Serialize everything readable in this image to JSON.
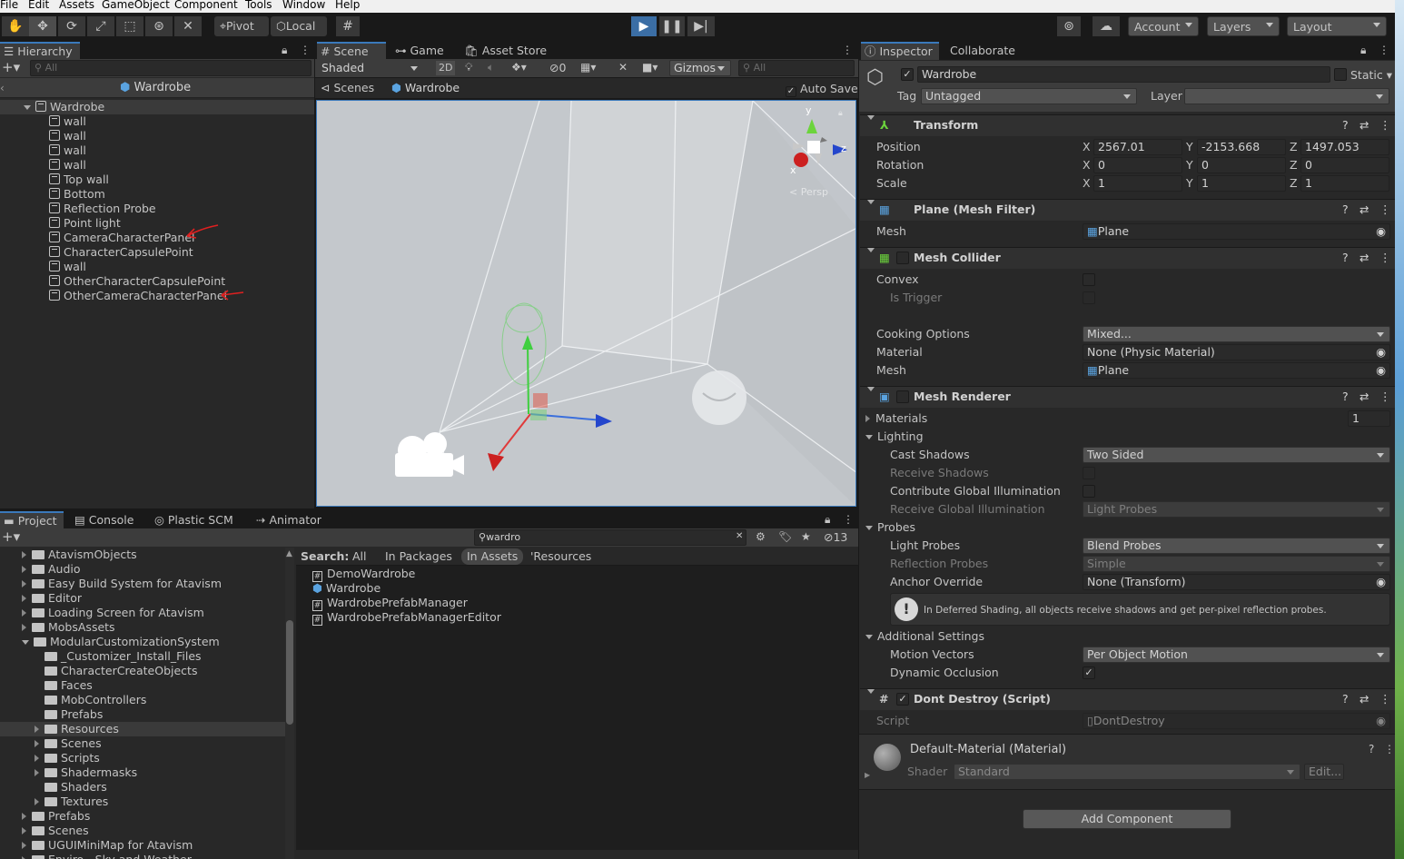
{
  "menu": [
    "File",
    "Edit",
    "Assets",
    "GameObject",
    "Component",
    "Tools",
    "Window",
    "Help"
  ],
  "toolbar": {
    "pivot": "Pivot",
    "local": "Local",
    "account": "Account",
    "layers": "Layers",
    "layout": "Layout"
  },
  "hierarchy": {
    "tab": "Hierarchy",
    "search_placeholder": "All",
    "scene_title": "Wardrobe",
    "root": "Wardrobe",
    "items": [
      "wall",
      "wall",
      "wall",
      "wall",
      "Top wall",
      "Bottom",
      "Reflection Probe",
      "Point light",
      "CameraCharacterPanel",
      "CharacterCapsulePoint",
      "wall",
      "OtherCharacterCapsulePoint",
      "OtherCameraCharacterPanel"
    ]
  },
  "scene": {
    "tabs": [
      "Scene",
      "Game",
      "Asset Store"
    ],
    "shading": "Shaded",
    "mode_2d": "2D",
    "hidden_count": "0",
    "gizmos": "Gizmos",
    "search_placeholder": "All",
    "breadcrumb_scenes": "Scenes",
    "breadcrumb_object": "Wardrobe",
    "auto_save": "Auto Save",
    "gizmo_y": "y",
    "gizmo_z": "z",
    "gizmo_x": "x",
    "persp": "Persp"
  },
  "project": {
    "tabs": [
      "Project",
      "Console",
      "Plastic SCM",
      "Animator"
    ],
    "search_value": "wardro",
    "visible_count": "13",
    "search_label": "Search:",
    "filters": [
      "All",
      "In Packages",
      "In Assets",
      "'Resources"
    ],
    "tree": [
      {
        "label": "AtavismObjects",
        "indent": 0,
        "open": false
      },
      {
        "label": "Audio",
        "indent": 0,
        "open": false
      },
      {
        "label": "Easy Build System for Atavism",
        "indent": 0,
        "open": false
      },
      {
        "label": "Editor",
        "indent": 0,
        "open": false
      },
      {
        "label": "Loading Screen for Atavism",
        "indent": 0,
        "open": false
      },
      {
        "label": "MobsAssets",
        "indent": 0,
        "open": false
      },
      {
        "label": "ModularCustomizationSystem",
        "indent": 0,
        "open": true
      },
      {
        "label": "_Customizer_Install_Files",
        "indent": 1,
        "open": null
      },
      {
        "label": "CharacterCreateObjects",
        "indent": 1,
        "open": null
      },
      {
        "label": "Faces",
        "indent": 1,
        "open": null
      },
      {
        "label": "MobControllers",
        "indent": 1,
        "open": null
      },
      {
        "label": "Prefabs",
        "indent": 1,
        "open": null
      },
      {
        "label": "Resources",
        "indent": 1,
        "open": false
      },
      {
        "label": "Scenes",
        "indent": 1,
        "open": false
      },
      {
        "label": "Scripts",
        "indent": 1,
        "open": false
      },
      {
        "label": "Shadermasks",
        "indent": 1,
        "open": false
      },
      {
        "label": "Shaders",
        "indent": 1,
        "open": null
      },
      {
        "label": "Textures",
        "indent": 1,
        "open": false
      },
      {
        "label": "Prefabs",
        "indent": 0,
        "open": false
      },
      {
        "label": "Scenes",
        "indent": 0,
        "open": false
      },
      {
        "label": "UGUIMiniMap for Atavism",
        "indent": 0,
        "open": false
      },
      {
        "label": "Enviro - Sky and Weather",
        "indent": 0,
        "open": false
      }
    ],
    "results": [
      {
        "label": "DemoWardrobe",
        "icon": "script-icon"
      },
      {
        "label": "Wardrobe",
        "icon": "prefab-icon"
      },
      {
        "label": "WardrobePrefabManager",
        "icon": "script-icon"
      },
      {
        "label": "WardrobePrefabManagerEditor",
        "icon": "script-icon"
      }
    ]
  },
  "inspector": {
    "tabs": [
      "Inspector",
      "Collaborate"
    ],
    "object_name": "Wardrobe",
    "static": "Static",
    "tag_label": "Tag",
    "tag_value": "Untagged",
    "layer_label": "Layer",
    "layer_value": "",
    "transform": {
      "title": "Transform",
      "position_label": "Position",
      "rotation_label": "Rotation",
      "scale_label": "Scale",
      "px": "2567.01",
      "py": "-2153.668",
      "pz": "1497.053",
      "rx": "0",
      "ry": "0",
      "rz": "0",
      "sx": "1",
      "sy": "1",
      "sz": "1"
    },
    "mesh_filter": {
      "title": "Plane (Mesh Filter)",
      "mesh_label": "Mesh",
      "mesh_value": "Plane"
    },
    "mesh_collider": {
      "title": "Mesh Collider",
      "convex": "Convex",
      "is_trigger": "Is Trigger",
      "cooking_label": "Cooking Options",
      "cooking_value": "Mixed...",
      "material_label": "Material",
      "material_value": "None (Physic Material)",
      "mesh_label": "Mesh",
      "mesh_value": "Plane"
    },
    "mesh_renderer": {
      "title": "Mesh Renderer",
      "materials": "Materials",
      "materials_count": "1",
      "lighting": "Lighting",
      "cast_shadows": "Cast Shadows",
      "cast_shadows_value": "Two Sided",
      "receive_shadows": "Receive Shadows",
      "contribute_gi": "Contribute Global Illumination",
      "receive_gi": "Receive Global Illumination",
      "receive_gi_value": "Light Probes",
      "probes": "Probes",
      "light_probes": "Light Probes",
      "light_probes_value": "Blend Probes",
      "reflection_probes": "Reflection Probes",
      "reflection_probes_value": "Simple",
      "anchor_override": "Anchor Override",
      "anchor_override_value": "None (Transform)",
      "info": "In Deferred Shading, all objects receive shadows and get per-pixel reflection probes.",
      "additional": "Additional Settings",
      "motion_vectors": "Motion Vectors",
      "motion_vectors_value": "Per Object Motion",
      "dynamic_occlusion": "Dynamic Occlusion"
    },
    "dont_destroy": {
      "title": "Dont Destroy (Script)",
      "script_label": "Script",
      "script_value": "DontDestroy"
    },
    "material": {
      "title": "Default-Material (Material)",
      "shader_label": "Shader",
      "shader_value": "Standard",
      "edit": "Edit..."
    },
    "add_component": "Add Component"
  },
  "colors": {
    "accent": "#3a79bb",
    "play_bg": "#3b6ea5",
    "annotation_arrow": "#e02020"
  }
}
